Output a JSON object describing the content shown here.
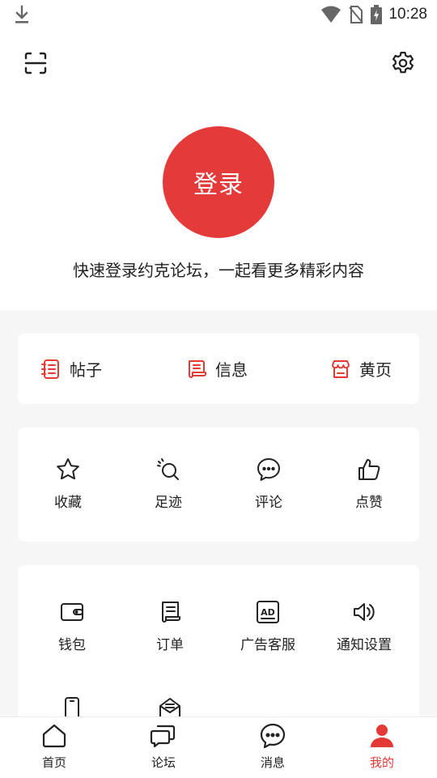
{
  "status_bar": {
    "time": "10:28"
  },
  "header": {
    "login_label": "登录",
    "login_hint": "快速登录约克论坛，一起看更多精彩内容"
  },
  "quick_links": [
    {
      "label": "帖子",
      "icon": "posts-icon"
    },
    {
      "label": "信息",
      "icon": "info-icon"
    },
    {
      "label": "黄页",
      "icon": "yellow-pages-icon"
    }
  ],
  "activity": [
    {
      "label": "收藏",
      "icon": "star-icon"
    },
    {
      "label": "足迹",
      "icon": "footprint-icon"
    },
    {
      "label": "评论",
      "icon": "comment-icon"
    },
    {
      "label": "点赞",
      "icon": "thumbs-up-icon"
    }
  ],
  "services": [
    {
      "label": "钱包",
      "icon": "wallet-icon"
    },
    {
      "label": "订单",
      "icon": "order-icon"
    },
    {
      "label": "广告客服",
      "icon": "ad-icon"
    },
    {
      "label": "通知设置",
      "icon": "speaker-icon"
    }
  ],
  "bottom_nav": [
    {
      "label": "首页",
      "icon": "home-icon"
    },
    {
      "label": "论坛",
      "icon": "forum-icon"
    },
    {
      "label": "消息",
      "icon": "message-icon"
    },
    {
      "label": "我的",
      "icon": "user-icon",
      "active": true
    }
  ],
  "colors": {
    "accent": "#e53935",
    "background": "#f6f6f6"
  }
}
